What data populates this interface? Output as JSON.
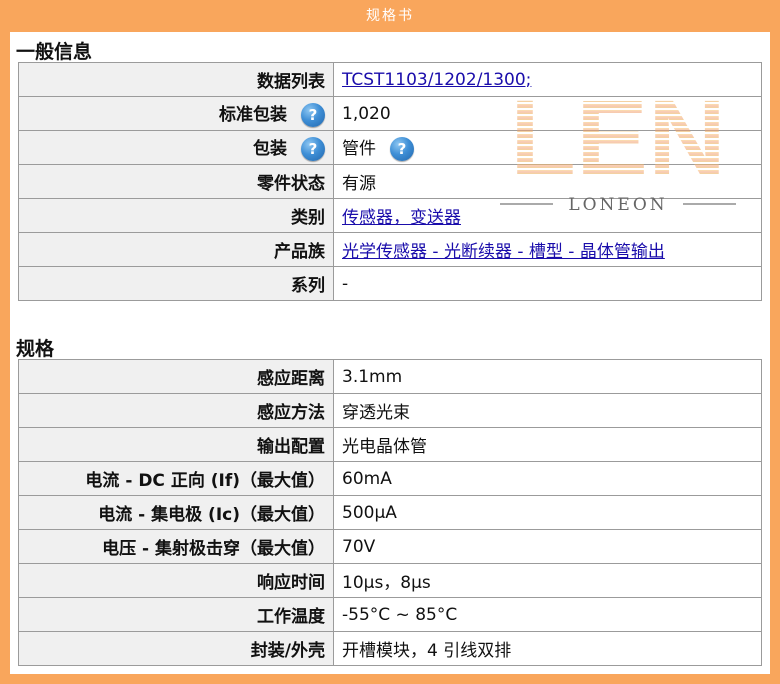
{
  "header": {
    "title": "规格书"
  },
  "general": {
    "title": "一般信息",
    "rows": [
      {
        "label": "数据列表",
        "value": "TCST1103/1202/1300;",
        "link": true,
        "help": false
      },
      {
        "label": "标准包装",
        "value": "1,020",
        "link": false,
        "help": true
      },
      {
        "label": "包装",
        "value": "管件",
        "link": false,
        "help": true,
        "value_help": true
      },
      {
        "label": "零件状态",
        "value": "有源",
        "link": false,
        "help": false
      },
      {
        "label": "类别",
        "value": "传感器，变送器",
        "link": true,
        "help": false
      },
      {
        "label": "产品族",
        "value": "光学传感器 - 光断续器 - 槽型 - 晶体管输出",
        "link": true,
        "help": false
      },
      {
        "label": "系列",
        "value": "-",
        "link": false,
        "help": false
      }
    ]
  },
  "specs": {
    "title": "规格",
    "rows": [
      {
        "label": "感应距离",
        "value": "3.1mm"
      },
      {
        "label": "感应方法",
        "value": "穿透光束"
      },
      {
        "label": "输出配置",
        "value": "光电晶体管"
      },
      {
        "label": "电流 - DC 正向 (If)（最大值）",
        "value": "60mA"
      },
      {
        "label": "电流 - 集电极 (Ic)（最大值）",
        "value": "500µA"
      },
      {
        "label": "电压 - 集射极击穿（最大值）",
        "value": "70V"
      },
      {
        "label": "响应时间",
        "value": "10µs，8µs"
      },
      {
        "label": "工作温度",
        "value": "-55°C ~ 85°C"
      },
      {
        "label": "封装/外壳",
        "value": "开槽模块，4 引线双排"
      }
    ]
  },
  "icons": {
    "help": "help-question-icon"
  },
  "watermark": {
    "brand": "LEN",
    "text": "LONEON"
  },
  "colors": {
    "accent": "#f9a65c",
    "link": "#1a0dab",
    "label_bg": "#f0f0f0",
    "border": "#9b9b9b"
  }
}
